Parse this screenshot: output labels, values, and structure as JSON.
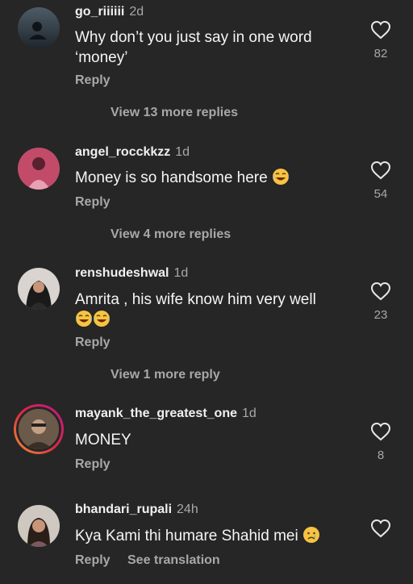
{
  "comments": [
    {
      "username": "go_riiiiii",
      "time": "2d",
      "line1": "Why don’t you just say in one word",
      "line2": "‘money’",
      "likes": "82",
      "reply": "Reply",
      "view_more": "View 13 more replies"
    },
    {
      "username": "angel_rocckkzz",
      "time": "1d",
      "line1": "Money is so handsome here",
      "likes": "54",
      "reply": "Reply",
      "view_more": "View 4 more replies"
    },
    {
      "username": "renshudeshwal",
      "time": "1d",
      "line1": "Amrita , his wife know him very well",
      "likes": "23",
      "reply": "Reply",
      "view_more": "View 1 more reply"
    },
    {
      "username": "mayank_the_greatest_one",
      "time": "1d",
      "line1": "MONEY",
      "likes": "8",
      "reply": "Reply"
    },
    {
      "username": "bhandari_rupali",
      "time": "24h",
      "line1": "Kya Kami thi humare Shahid mei",
      "reply": "Reply",
      "see_translation": "See translation"
    }
  ]
}
